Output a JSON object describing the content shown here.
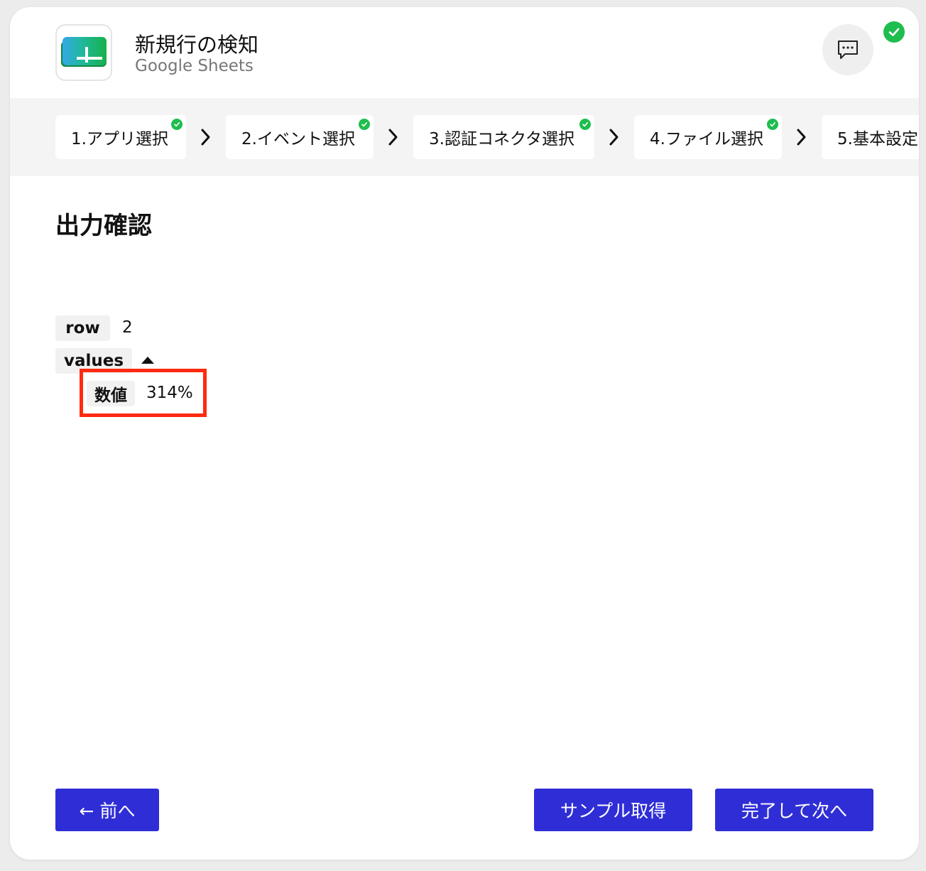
{
  "header": {
    "title": "新規行の検知",
    "subtitle": "Google Sheets"
  },
  "steps": [
    {
      "label": "1.アプリ選択",
      "done": true
    },
    {
      "label": "2.イベント選択",
      "done": true
    },
    {
      "label": "3.認証コネクタ選択",
      "done": true
    },
    {
      "label": "4.ファイル選択",
      "done": true
    },
    {
      "label": "5.基本設定",
      "done": false
    }
  ],
  "output": {
    "title": "出力確認",
    "row_key": "row",
    "row_value": "2",
    "values_key": "values",
    "values_item_key": "数値",
    "values_item_value": "314%"
  },
  "buttons": {
    "prev": "← 前へ",
    "sample": "サンプル取得",
    "next": "完了して次へ"
  },
  "colors": {
    "accent": "#2f2ed6",
    "success": "#1fbd4e",
    "highlight": "#ff2a10",
    "sheets_green": "#1a9e4f"
  },
  "icons": {
    "app": "google-sheets-icon",
    "chat": "chat-bubble-icon",
    "status": "check-circle-icon",
    "toggle": "triangle-up-icon",
    "separator": "chevron-right-icon"
  }
}
